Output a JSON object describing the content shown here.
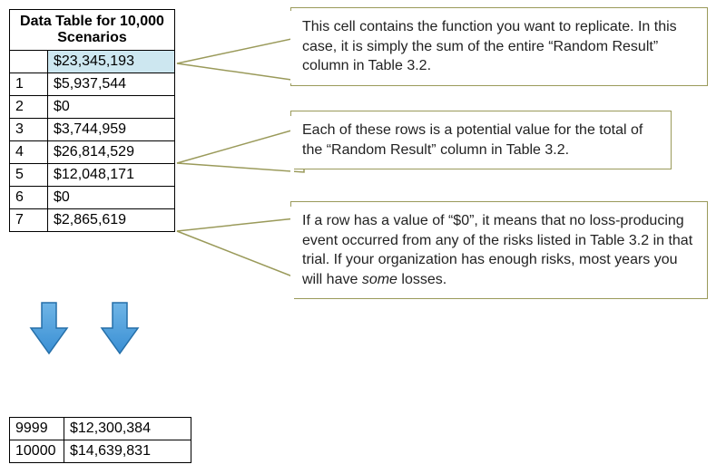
{
  "table": {
    "title": "Data Table for 10,000 Scenarios",
    "header_value": "$23,345,193",
    "rows": [
      {
        "idx": "1",
        "val": "$5,937,544"
      },
      {
        "idx": "2",
        "val": "$0"
      },
      {
        "idx": "3",
        "val": "$3,744,959"
      },
      {
        "idx": "4",
        "val": "$26,814,529"
      },
      {
        "idx": "5",
        "val": "$12,048,171"
      },
      {
        "idx": "6",
        "val": "$0"
      },
      {
        "idx": "7",
        "val": "$2,865,619"
      }
    ],
    "tail_rows": [
      {
        "idx": "9999",
        "val": "$12,300,384"
      },
      {
        "idx": "10000",
        "val": "$14,639,831"
      }
    ]
  },
  "callouts": {
    "c1": "This cell contains the function you want to replicate. In this case, it is simply the sum of the entire “Random Result” column in Table 3.2.",
    "c2": "Each of these rows is a potential value for the total of the “Random Result” column in Table 3.2.",
    "c3_pre": "If a row has a value of “$0”, it means that no loss-producing event occurred from any of the risks listed in Table 3.2 in that trial. If your organization has enough risks, most years you will have ",
    "c3_em": "some",
    "c3_post": " losses."
  }
}
